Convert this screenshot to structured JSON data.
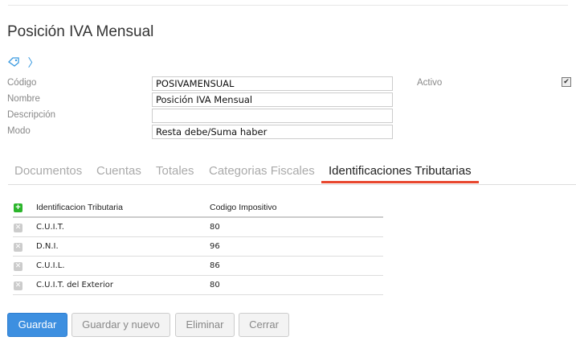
{
  "title": "Posición IVA Mensual",
  "form": {
    "codigo_label": "Código",
    "codigo": "POSIVAMENSUAL",
    "nombre_label": "Nombre",
    "nombre": "Posición IVA Mensual",
    "descripcion_label": "Descripción",
    "descripcion": "",
    "modo_label": "Modo",
    "modo": "Resta debe/Suma haber",
    "activo_label": "Activo",
    "activo_check": "✔"
  },
  "tabs": [
    "Documentos",
    "Cuentas",
    "Totales",
    "Categorias Fiscales",
    "Identificaciones Tributarias"
  ],
  "table": {
    "headers": [
      "Identificacion Tributaria",
      "Codigo Impositivo"
    ],
    "rows": [
      [
        "C.U.I.T.",
        "80"
      ],
      [
        "D.N.I.",
        "96"
      ],
      [
        "C.U.I.L.",
        "86"
      ],
      [
        "C.U.I.T. del Exterior",
        "80"
      ]
    ]
  },
  "buttons": {
    "guardar": "Guardar",
    "guardar_nuevo": "Guardar y nuevo",
    "eliminar": "Eliminar",
    "cerrar": "Cerrar"
  }
}
